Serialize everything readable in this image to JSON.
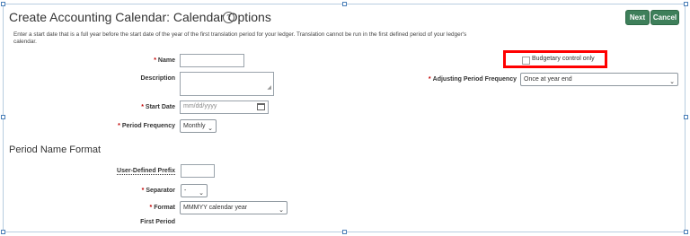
{
  "page": {
    "title": "Create Accounting Calendar: Calendar Options",
    "help_icon": "?",
    "next_label": "Next",
    "cancel_label": "Cancel",
    "instructions": "Enter a start date that is a full year before the start date of the year of the first translation period for your ledger. Translation cannot be run in the first defined period of your ledger's calendar."
  },
  "form": {
    "required_marker": "*",
    "name_label": "Name",
    "name_value": "",
    "description_label": "Description",
    "description_value": "",
    "start_date_label": "Start Date",
    "start_date_placeholder": "mm/dd/yyyy",
    "period_frequency_label": "Period Frequency",
    "period_frequency_value": "Monthly",
    "budgetary_control_label": "Budgetary control only",
    "budgetary_control_checked": false,
    "adjusting_frequency_label": "Adjusting Period Frequency",
    "adjusting_frequency_value": "Once at year end"
  },
  "period_name_format": {
    "section_title": "Period Name Format",
    "prefix_label": "User-Defined Prefix",
    "prefix_value": "",
    "separator_label": "Separator",
    "separator_value": "-",
    "format_label": "Format",
    "format_value": "MMMYY calendar year",
    "first_period_label": "First Period"
  },
  "colors": {
    "accent_button": "#3e7f5a",
    "highlight_box": "#ff0000",
    "required_marker": "#c00000"
  },
  "icons": {
    "calendar": "calendar-icon",
    "dropdown": "chevron-down-icon",
    "help": "help-icon"
  }
}
